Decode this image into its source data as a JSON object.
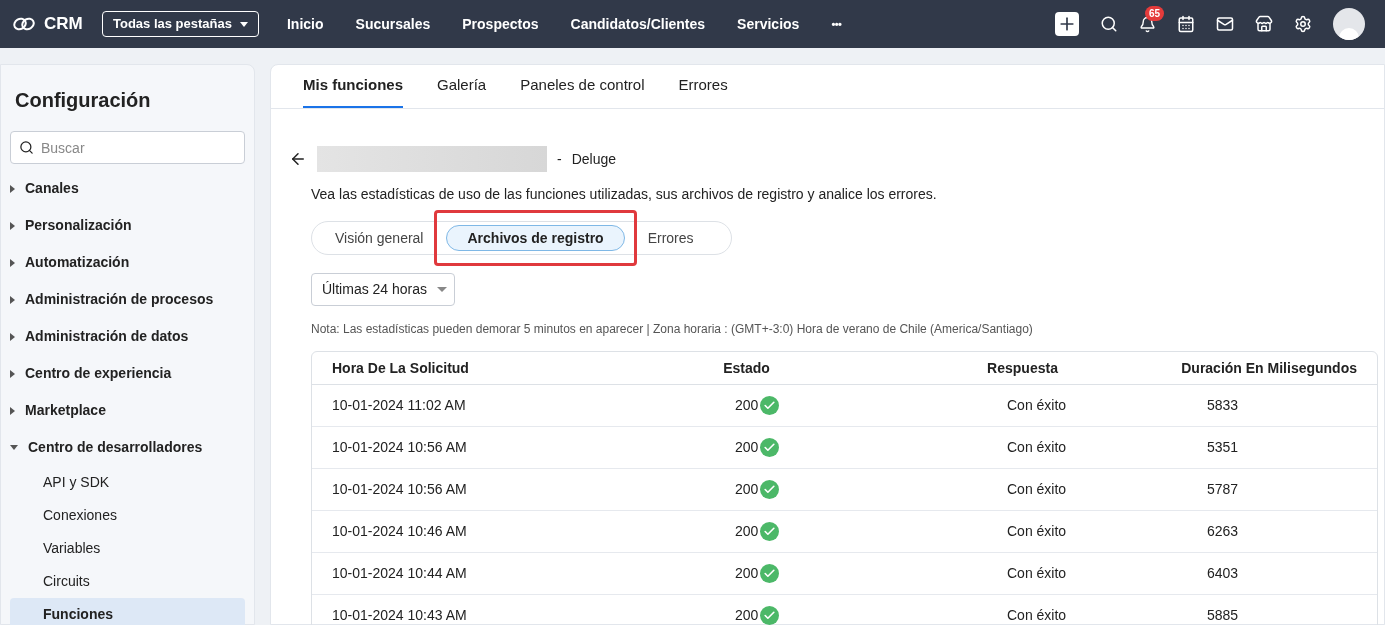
{
  "topbar": {
    "logo": "CRM",
    "tabs_menu": "Todas las pestañas",
    "nav": [
      "Inicio",
      "Sucursales",
      "Prospectos",
      "Candidatos/Clientes",
      "Servicios"
    ],
    "more": "•••",
    "notifications": "65"
  },
  "sidebar": {
    "title": "Configuración",
    "search": {
      "placeholder": "Buscar"
    },
    "items": [
      {
        "label": "Canales",
        "expanded": false
      },
      {
        "label": "Personalización",
        "expanded": false
      },
      {
        "label": "Automatización",
        "expanded": false
      },
      {
        "label": "Administración de procesos",
        "expanded": false
      },
      {
        "label": "Administración de datos",
        "expanded": false
      },
      {
        "label": "Centro de experiencia",
        "expanded": false
      },
      {
        "label": "Marketplace",
        "expanded": false
      },
      {
        "label": "Centro de desarrolladores",
        "expanded": true,
        "children": [
          {
            "label": "API y SDK",
            "selected": false
          },
          {
            "label": "Conexiones",
            "selected": false
          },
          {
            "label": "Variables",
            "selected": false
          },
          {
            "label": "Circuits",
            "selected": false
          },
          {
            "label": "Funciones",
            "selected": true
          }
        ]
      }
    ]
  },
  "tabs": [
    {
      "label": "Mis funciones",
      "selected": true
    },
    {
      "label": "Galería",
      "selected": false
    },
    {
      "label": "Paneles de control",
      "selected": false
    },
    {
      "label": "Errores",
      "selected": false
    }
  ],
  "function": {
    "separator": "-",
    "language": "Deluge",
    "description": "Vea las estadísticas de uso de las funciones utilizadas, sus archivos de registro y analice los errores."
  },
  "segments": [
    {
      "label": "Visión general",
      "selected": false,
      "highlighted": false
    },
    {
      "label": "Archivos de registro",
      "selected": true,
      "highlighted": true
    },
    {
      "label": "Errores",
      "selected": false,
      "highlighted": false
    }
  ],
  "period": "Últimas 24 horas",
  "note": "Nota: Las estadísticas pueden demorar 5 minutos en aparecer | Zona horaria : (GMT+-3:0) Hora de verano de Chile (America/Santiago)",
  "table": {
    "columns": [
      "Hora De La Solicitud",
      "Estado",
      "Respuesta",
      "Duración En Milisegundos"
    ],
    "rows": [
      {
        "time": "10-01-2024 11:02 AM",
        "status": "200",
        "success": true,
        "response": "Con éxito",
        "duration": "5833"
      },
      {
        "time": "10-01-2024 10:56 AM",
        "status": "200",
        "success": true,
        "response": "Con éxito",
        "duration": "5351"
      },
      {
        "time": "10-01-2024 10:56 AM",
        "status": "200",
        "success": true,
        "response": "Con éxito",
        "duration": "5787"
      },
      {
        "time": "10-01-2024 10:46 AM",
        "status": "200",
        "success": true,
        "response": "Con éxito",
        "duration": "6263"
      },
      {
        "time": "10-01-2024 10:44 AM",
        "status": "200",
        "success": true,
        "response": "Con éxito",
        "duration": "6403"
      },
      {
        "time": "10-01-2024 10:43 AM",
        "status": "200",
        "success": true,
        "response": "Con éxito",
        "duration": "5885"
      }
    ]
  }
}
